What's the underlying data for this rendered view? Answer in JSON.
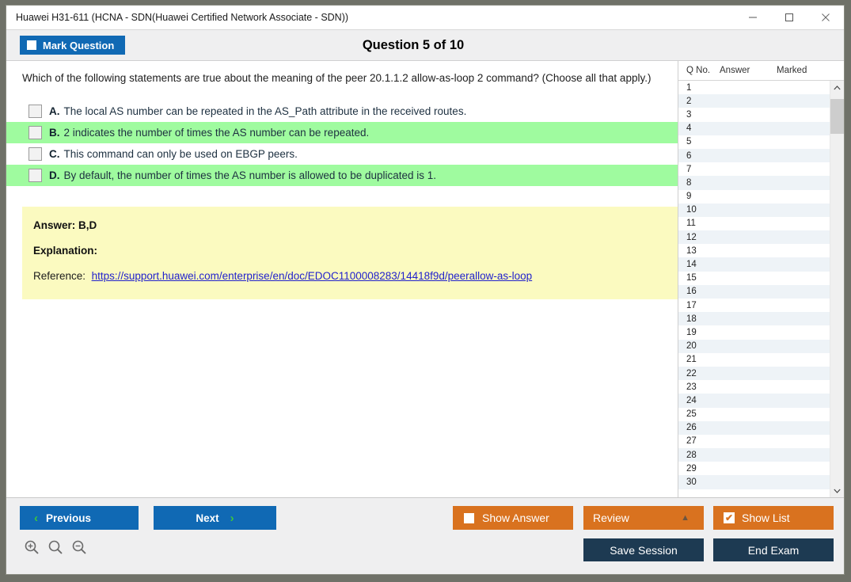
{
  "window": {
    "title": "Huawei H31-611 (HCNA - SDN(Huawei Certified Network Associate - SDN))",
    "minimize_label": "minimize",
    "maximize_label": "maximize",
    "close_label": "close"
  },
  "header": {
    "mark_question_label": "Mark Question",
    "question_counter": "Question 5 of 10"
  },
  "question": {
    "text": "Which of the following statements are true about the meaning of the peer 20.1.1.2 allow-as-loop 2 command? (Choose all that apply.)",
    "options": [
      {
        "letter": "A.",
        "text": "The local AS number can be repeated in the AS_Path attribute in the received routes.",
        "highlighted": false,
        "checked": false
      },
      {
        "letter": "B.",
        "text": "2 indicates the number of times the AS number can be repeated.",
        "highlighted": true,
        "checked": false
      },
      {
        "letter": "C.",
        "text": "This command can only be used on EBGP peers.",
        "highlighted": false,
        "checked": false
      },
      {
        "letter": "D.",
        "text": "By default, the number of times the AS number is allowed to be duplicated is 1.",
        "highlighted": true,
        "checked": false
      }
    ]
  },
  "answer_panel": {
    "answer_label": "Answer: B,D",
    "explanation_label": "Explanation:",
    "reference_label": "Reference:",
    "reference_url": "https://support.huawei.com/enterprise/en/doc/EDOC1100008283/14418f9d/peerallow-as-loop"
  },
  "list_panel": {
    "columns": [
      "Q No.",
      "Answer",
      "Marked"
    ],
    "rows": [
      {
        "no": "1",
        "answer": "",
        "marked": ""
      },
      {
        "no": "2",
        "answer": "",
        "marked": ""
      },
      {
        "no": "3",
        "answer": "",
        "marked": ""
      },
      {
        "no": "4",
        "answer": "",
        "marked": ""
      },
      {
        "no": "5",
        "answer": "",
        "marked": ""
      },
      {
        "no": "6",
        "answer": "",
        "marked": ""
      },
      {
        "no": "7",
        "answer": "",
        "marked": ""
      },
      {
        "no": "8",
        "answer": "",
        "marked": ""
      },
      {
        "no": "9",
        "answer": "",
        "marked": ""
      },
      {
        "no": "10",
        "answer": "",
        "marked": ""
      },
      {
        "no": "11",
        "answer": "",
        "marked": ""
      },
      {
        "no": "12",
        "answer": "",
        "marked": ""
      },
      {
        "no": "13",
        "answer": "",
        "marked": ""
      },
      {
        "no": "14",
        "answer": "",
        "marked": ""
      },
      {
        "no": "15",
        "answer": "",
        "marked": ""
      },
      {
        "no": "16",
        "answer": "",
        "marked": ""
      },
      {
        "no": "17",
        "answer": "",
        "marked": ""
      },
      {
        "no": "18",
        "answer": "",
        "marked": ""
      },
      {
        "no": "19",
        "answer": "",
        "marked": ""
      },
      {
        "no": "20",
        "answer": "",
        "marked": ""
      },
      {
        "no": "21",
        "answer": "",
        "marked": ""
      },
      {
        "no": "22",
        "answer": "",
        "marked": ""
      },
      {
        "no": "23",
        "answer": "",
        "marked": ""
      },
      {
        "no": "24",
        "answer": "",
        "marked": ""
      },
      {
        "no": "25",
        "answer": "",
        "marked": ""
      },
      {
        "no": "26",
        "answer": "",
        "marked": ""
      },
      {
        "no": "27",
        "answer": "",
        "marked": ""
      },
      {
        "no": "28",
        "answer": "",
        "marked": ""
      },
      {
        "no": "29",
        "answer": "",
        "marked": ""
      },
      {
        "no": "30",
        "answer": "",
        "marked": ""
      }
    ]
  },
  "footer": {
    "previous_label": "Previous",
    "next_label": "Next",
    "prev_chevron": "‹",
    "next_chevron": "›",
    "show_answer_label": "Show Answer",
    "review_label": "Review",
    "review_caret": "▲",
    "show_list_label": "Show List",
    "show_list_checked": "✔",
    "save_session_label": "Save Session",
    "end_exam_label": "End Exam",
    "zoom_in_label": "zoom-in",
    "zoom_reset_label": "zoom-reset",
    "zoom_out_label": "zoom-out"
  },
  "colors": {
    "primary_blue": "#1069b4",
    "orange": "#d9721f",
    "dark_navy": "#1d3a52",
    "highlight_green": "#9ffb9f",
    "answer_yellow": "#fbfac0",
    "link_blue": "#2222cc",
    "chevron_green": "#3cc63c"
  }
}
